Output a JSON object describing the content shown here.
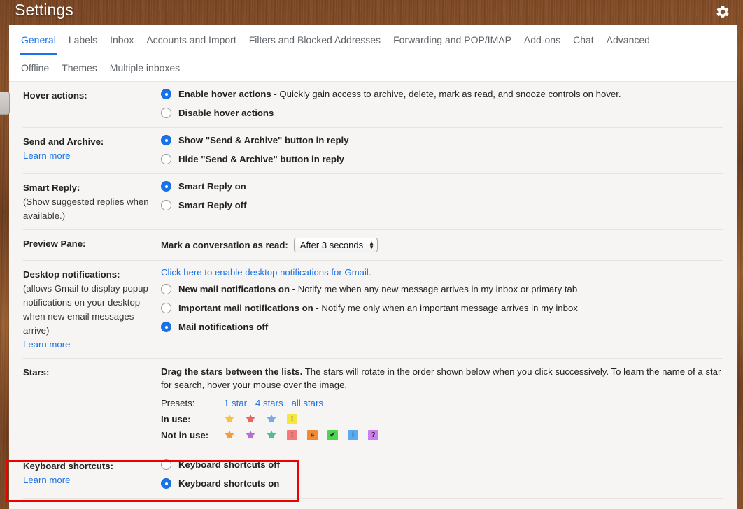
{
  "window": {
    "title": "Settings",
    "gear_icon": "gear-icon"
  },
  "tabs": {
    "row1": [
      {
        "label": "General",
        "active": true
      },
      {
        "label": "Labels",
        "active": false
      },
      {
        "label": "Inbox",
        "active": false
      },
      {
        "label": "Accounts and Import",
        "active": false
      },
      {
        "label": "Filters and Blocked Addresses",
        "active": false
      },
      {
        "label": "Forwarding and POP/IMAP",
        "active": false
      },
      {
        "label": "Add-ons",
        "active": false
      },
      {
        "label": "Chat",
        "active": false
      },
      {
        "label": "Advanced",
        "active": false
      }
    ],
    "row2": [
      {
        "label": "Offline",
        "active": false
      },
      {
        "label": "Themes",
        "active": false
      },
      {
        "label": "Multiple inboxes",
        "active": false
      }
    ]
  },
  "settings": {
    "hover_actions": {
      "label": "Hover actions:",
      "options": [
        {
          "bold": "Enable hover actions",
          "rest": " - Quickly gain access to archive, delete, mark as read, and snooze controls on hover.",
          "selected": true
        },
        {
          "bold": "Disable hover actions",
          "rest": "",
          "selected": false
        }
      ]
    },
    "send_and_archive": {
      "label": "Send and Archive:",
      "learn_more": "Learn more",
      "options": [
        {
          "bold": "Show \"Send & Archive\" button in reply",
          "rest": "",
          "selected": true
        },
        {
          "bold": "Hide \"Send & Archive\" button in reply",
          "rest": "",
          "selected": false
        }
      ]
    },
    "smart_reply": {
      "label": "Smart Reply:",
      "sub": "(Show suggested replies when available.)",
      "options": [
        {
          "bold": "Smart Reply on",
          "rest": "",
          "selected": true
        },
        {
          "bold": "Smart Reply off",
          "rest": "",
          "selected": false
        }
      ]
    },
    "preview_pane": {
      "label": "Preview Pane:",
      "mark_read_label": "Mark a conversation as read:",
      "select_value": "After 3 seconds"
    },
    "desktop_notifications": {
      "label": "Desktop notifications:",
      "sub": "(allows Gmail to display popup notifications on your desktop when new email messages arrive)",
      "learn_more": "Learn more",
      "enable_link": "Click here to enable desktop notifications for Gmail.",
      "options": [
        {
          "bold": "New mail notifications on",
          "rest": " - Notify me when any new message arrives in my inbox or primary tab",
          "selected": false
        },
        {
          "bold": "Important mail notifications on",
          "rest": " - Notify me only when an important message arrives in my inbox",
          "selected": false
        },
        {
          "bold": "Mail notifications off",
          "rest": "",
          "selected": true
        }
      ]
    },
    "stars": {
      "label": "Stars:",
      "desc_bold": "Drag the stars between the lists.",
      "desc_rest": " The stars will rotate in the order shown below when you click successively. To learn the name of a star for search, hover your mouse over the image.",
      "presets_label": "Presets:",
      "presets": [
        "1 star",
        "4 stars",
        "all stars"
      ],
      "in_use_label": "In use:",
      "in_use": [
        {
          "type": "star",
          "color": "#f5c542",
          "name": "yellow-star"
        },
        {
          "type": "star",
          "color": "#e8675a",
          "name": "red-star"
        },
        {
          "type": "star",
          "color": "#7aa9e8",
          "name": "blue-star"
        },
        {
          "type": "badge",
          "color": "#f5e642",
          "glyph": "!",
          "name": "yellow-bang-badge"
        }
      ],
      "not_in_use_label": "Not in use:",
      "not_in_use": [
        {
          "type": "star",
          "color": "#f59b3c",
          "name": "orange-star"
        },
        {
          "type": "star",
          "color": "#b072d8",
          "name": "purple-star"
        },
        {
          "type": "star",
          "color": "#50bd8e",
          "name": "green-star"
        },
        {
          "type": "badge",
          "color": "#f27c7c",
          "glyph": "!",
          "name": "red-bang-badge"
        },
        {
          "type": "badge",
          "color": "#ef8b36",
          "glyph": "»",
          "name": "orange-double-arrow-badge"
        },
        {
          "type": "badge",
          "color": "#4ed44e",
          "glyph": "✔",
          "name": "green-check-badge"
        },
        {
          "type": "badge",
          "color": "#5aabf0",
          "glyph": "i",
          "name": "blue-info-badge"
        },
        {
          "type": "badge",
          "color": "#cc7ef0",
          "glyph": "?",
          "name": "purple-question-badge"
        }
      ]
    },
    "keyboard_shortcuts": {
      "label": "Keyboard shortcuts:",
      "learn_more": "Learn more",
      "options": [
        {
          "bold": "Keyboard shortcuts off",
          "rest": "",
          "selected": false
        },
        {
          "bold": "Keyboard shortcuts on",
          "rest": "",
          "selected": true
        }
      ]
    }
  },
  "annotation": {
    "highlight_color": "#ee0000"
  }
}
